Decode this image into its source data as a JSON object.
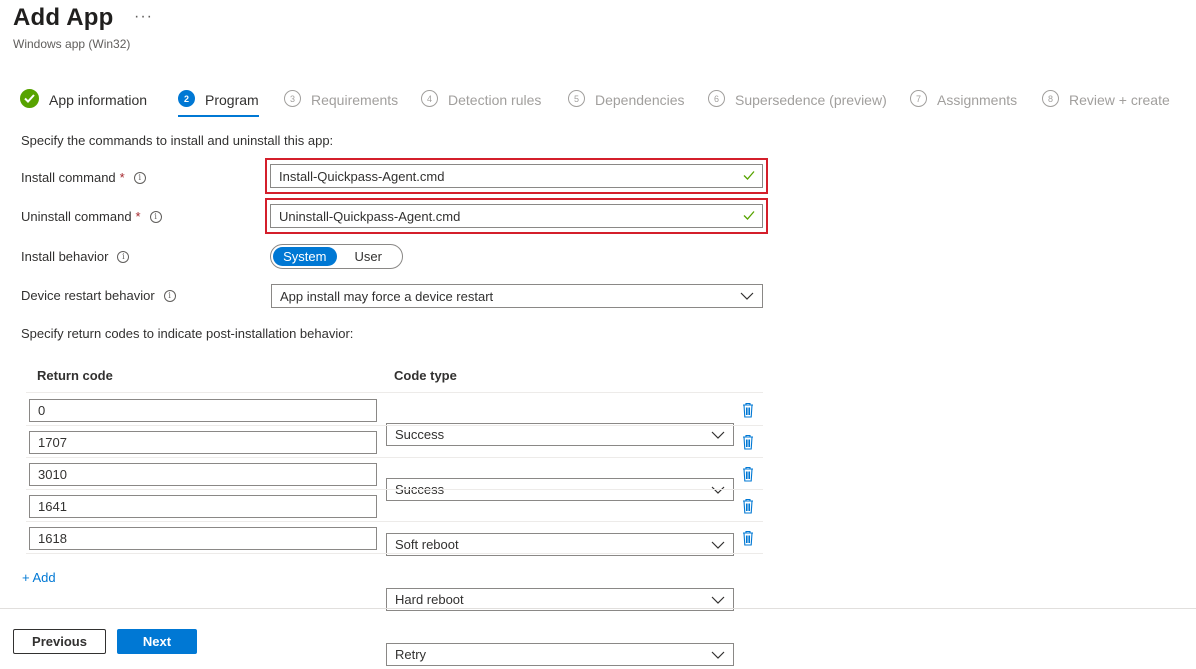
{
  "header": {
    "title": "Add App",
    "more": "···",
    "subtitle": "Windows app (Win32)"
  },
  "steps": [
    {
      "num": "",
      "label": "App information",
      "state": "done"
    },
    {
      "num": "2",
      "label": "Program",
      "state": "active"
    },
    {
      "num": "3",
      "label": "Requirements",
      "state": "pending"
    },
    {
      "num": "4",
      "label": "Detection rules",
      "state": "pending"
    },
    {
      "num": "5",
      "label": "Dependencies",
      "state": "pending"
    },
    {
      "num": "6",
      "label": "Supersedence (preview)",
      "state": "pending"
    },
    {
      "num": "7",
      "label": "Assignments",
      "state": "pending"
    },
    {
      "num": "8",
      "label": "Review + create",
      "state": "pending"
    }
  ],
  "form": {
    "intro": "Specify the commands to install and uninstall this app:",
    "install_label": "Install command",
    "install_value": "Install-Quickpass-Agent.cmd",
    "uninstall_label": "Uninstall command",
    "uninstall_value": "Uninstall-Quickpass-Agent.cmd",
    "required_mark": "*",
    "info_glyph": "i",
    "behavior_label": "Install behavior",
    "behavior_options": [
      "System",
      "User"
    ],
    "behavior_selected": "System",
    "restart_label": "Device restart behavior",
    "restart_value": "App install may force a device restart"
  },
  "return_codes": {
    "intro": "Specify return codes to indicate post-installation behavior:",
    "col_code": "Return code",
    "col_type": "Code type",
    "rows": [
      {
        "code": "0",
        "type": "Success"
      },
      {
        "code": "1707",
        "type": "Success"
      },
      {
        "code": "3010",
        "type": "Soft reboot"
      },
      {
        "code": "1641",
        "type": "Hard reboot"
      },
      {
        "code": "1618",
        "type": "Retry"
      }
    ],
    "add_label": "+ Add"
  },
  "footer": {
    "previous": "Previous",
    "next": "Next"
  },
  "colors": {
    "accent": "#0078d4",
    "success": "#57a300",
    "highlight": "#d41f2b"
  }
}
